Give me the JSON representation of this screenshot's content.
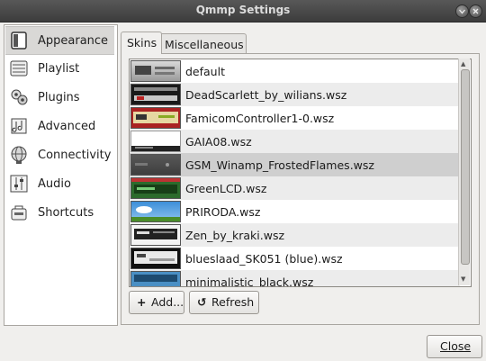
{
  "window": {
    "title": "Qmmp Settings"
  },
  "sidebar": {
    "items": [
      {
        "label": "Appearance",
        "icon": "appearance-icon",
        "selected": true
      },
      {
        "label": "Playlist",
        "icon": "playlist-icon"
      },
      {
        "label": "Plugins",
        "icon": "plugins-icon"
      },
      {
        "label": "Advanced",
        "icon": "advanced-icon"
      },
      {
        "label": "Connectivity",
        "icon": "connectivity-icon"
      },
      {
        "label": "Audio",
        "icon": "audio-icon"
      },
      {
        "label": "Shortcuts",
        "icon": "shortcuts-icon"
      }
    ]
  },
  "tabs": [
    {
      "label": "Skins",
      "active": true
    },
    {
      "label": "Miscellaneous"
    }
  ],
  "skins": [
    {
      "name": "default"
    },
    {
      "name": "DeadScarlett_by_wilians.wsz"
    },
    {
      "name": "FamicomController1-0.wsz"
    },
    {
      "name": "GAIA08.wsz"
    },
    {
      "name": "GSM_Winamp_FrostedFlames.wsz",
      "selected": true
    },
    {
      "name": "GreenLCD.wsz"
    },
    {
      "name": "PRIRODA.wsz"
    },
    {
      "name": "Zen_by_kraki.wsz"
    },
    {
      "name": "blueslaad_SK051 (blue).wsz"
    },
    {
      "name": "minimalistic_black.wsz"
    }
  ],
  "buttons": {
    "add": "Add...",
    "refresh": "Refresh",
    "close": "Close"
  },
  "colors": {
    "titlebar": "#484848",
    "selection": "#cfcfcf",
    "window_bg": "#f0efed"
  }
}
